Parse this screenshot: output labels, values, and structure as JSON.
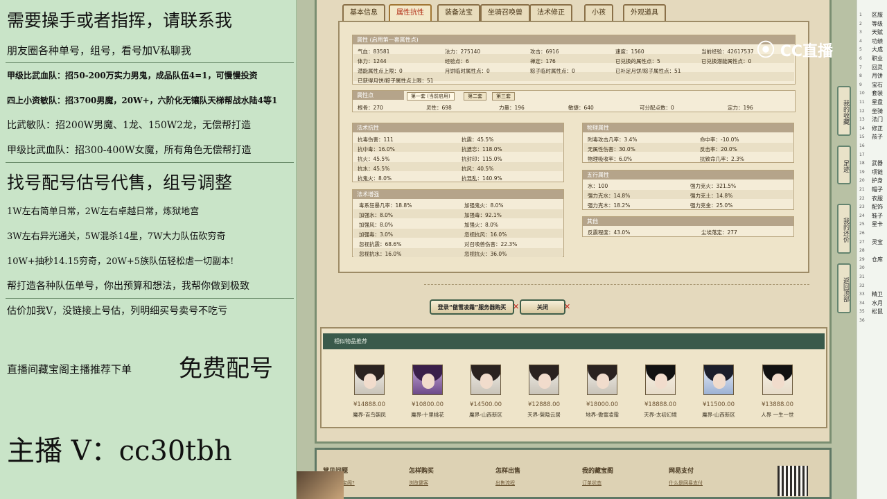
{
  "overlay": {
    "l1": "需要操手或者指挥，请联系我",
    "l2": "朋友圈各种单号，组号，看号加V私聊我",
    "l3": "甲级比武血队：招50-200万实力男鬼，成品队伍4=1，可慢慢投资",
    "l4": "四上小资敏队：招3700男魔，20W+，六阶化无镶队天梯帮战水陆4等1",
    "l5": "比武敏队：招200W男魔、1龙、150W2龙，无偿帮打造",
    "l6": "甲级比武血队：招300-400W女魔，所有角色无偿帮打造",
    "l7": "找号配号估号代售，组号调整",
    "l8": "1W左右简单日常，2W左右卓越日常，炼狱地宫",
    "l9": "3W左右异光通关，5W混杀14星，7W大力队伍砍穷奇",
    "l10": "10W+抽秒14.15穷奇，20W+5族队伍轻松虐一切副本!",
    "l11": "帮打造各种队伍单号，你出预算和想法，我帮你做到极致",
    "l12": "估价加我V，没链接上号估，列明细买号卖号不吃亏",
    "l13a": "直播间藏宝阁主播推荐下单",
    "l13b": "免费配号",
    "l14": "主播 V：cc30tbh"
  },
  "tabs": [
    "基本信息",
    "属性抗性",
    "装备法宝",
    "坐骑召唤兽",
    "法术修正",
    "小孩",
    "外观道具"
  ],
  "attr": {
    "title": "属性 (启用第一套属性点)",
    "r1": [
      "气血：83581",
      "法力：275140",
      "攻击：6916",
      "速度：1560",
      "当前经验：42617537"
    ],
    "r2": [
      "体力：1244",
      "经验点：6",
      "禅定：176",
      "已兑换的属性点：5",
      "已兑换潜能属性点：0"
    ],
    "r3": [
      "潜能属性点上限：0",
      "月饼临时属性点：0",
      "粽子临时属性点：0",
      "已补足月饼/粽子属性点：51"
    ],
    "r4": "已获得月饼/粽子属性点上限：51"
  },
  "points": {
    "title": "属性点",
    "subtabs": [
      "第一套 (当前启用)",
      "第二套",
      "第三套"
    ],
    "vals": [
      "根骨：270",
      "灵性：698",
      "力量：196",
      "敏捷：640",
      "可分配点数：0",
      "定力：196"
    ]
  },
  "resist": {
    "title": "法术抗性",
    "rows": [
      [
        "抗毒伤害：111",
        "抗震：45.5%"
      ],
      [
        "抗中毒：16.0%",
        "抗遗忘：118.0%"
      ],
      [
        "抗火：45.5%",
        "抗封印：115.0%"
      ],
      [
        "抗水：45.5%",
        "抗风：40.5%"
      ],
      [
        "抗鬼火：8.0%",
        "抗混乱：140.9%"
      ]
    ]
  },
  "boost": {
    "title": "法术增强",
    "rows": [
      [
        "毒系狂暴几率：18.8%",
        "加强鬼火：8.0%"
      ],
      [
        "加强水：8.0%",
        "加强毒：92.1%"
      ],
      [
        "加强风：8.0%",
        "加强火：8.0%"
      ],
      [
        "加强毒：3.0%",
        "忽视抗风：16.0%"
      ],
      [
        "忽视抗震：68.6%",
        "对召唤兽伤害：22.3%"
      ],
      [
        "忽视抗水：16.0%",
        "忽视抗火：36.0%"
      ]
    ]
  },
  "phys": {
    "title": "物理属性",
    "rows": [
      [
        "附毒攻击几率：3.4%",
        "命中率：-10.0%"
      ],
      [
        "无属性伤害：30.0%",
        "反击率：20.0%"
      ],
      [
        "物理吸收率：6.0%",
        "抗致命几率：2.3%"
      ]
    ]
  },
  "five": {
    "title": "五行属性",
    "rows": [
      [
        "水：100",
        "强力克火：321.5%"
      ],
      [
        "强力克水：14.8%",
        "强力克土：14.8%"
      ],
      [
        "强力克木：18.2%",
        "强力克金：25.0%"
      ]
    ]
  },
  "other": {
    "title": "其他",
    "row": [
      "反震程度：43.0%",
      "尘埃落定：277"
    ]
  },
  "buttons": {
    "buy": "登录“傲雪凌霜”服务器购买",
    "close": "关闭"
  },
  "rec": {
    "title": "相似物品推荐",
    "items": [
      {
        "price": "¥14888.00",
        "server": "魔界-百鸟朝凤"
      },
      {
        "price": "¥10800.00",
        "server": "魔界-十里桃花"
      },
      {
        "price": "¥14500.00",
        "server": "魔界-山西新区"
      },
      {
        "price": "¥12888.00",
        "server": "天界-鬓隐云居"
      },
      {
        "price": "¥18000.00",
        "server": "地界-傲雪凌霜"
      },
      {
        "price": "¥18888.00",
        "server": "天界-太初幻境"
      },
      {
        "price": "¥11500.00",
        "server": "魔界-山西新区"
      },
      {
        "price": "¥13888.00",
        "server": "人界 一生一世"
      }
    ]
  },
  "footer": {
    "cols": [
      "常见问题",
      "怎样购买",
      "怎样出售",
      "我的藏宝阁",
      "网易支付"
    ],
    "links": [
      "什么是藏宝阁?",
      "浏览健客",
      "出售流程",
      "订单状态",
      "什么是网易支付"
    ]
  },
  "side": [
    "我的收藏",
    "足迹",
    "我的还价",
    "返回顶部"
  ],
  "logo": "CC直播",
  "sheet": {
    "nums": [
      "1",
      "2",
      "3",
      "4",
      "5",
      "6",
      "7",
      "8",
      "9",
      "10",
      "11",
      "12",
      "13",
      "14",
      "15",
      "16",
      "17",
      "18",
      "19",
      "20",
      "21",
      "22",
      "23",
      "24",
      "25",
      "26",
      "27",
      "28",
      "29",
      "30",
      "31",
      "32",
      "33",
      "34",
      "35",
      "36"
    ],
    "txt": [
      "区服",
      "等级",
      "天赋",
      "功绩",
      "大成",
      "职业",
      "回灵",
      "月饼",
      "宝石",
      "套装",
      "星盘",
      "坐骑",
      "法门",
      "修正",
      "孩子",
      "",
      "",
      "武器",
      "项链",
      "护身",
      "帽子",
      "衣服",
      "配饰",
      "鞋子",
      "星卡",
      "",
      "灵宝",
      "",
      "仓库",
      "",
      "",
      "",
      "精卫",
      "水月",
      "松鼠",
      ""
    ]
  }
}
